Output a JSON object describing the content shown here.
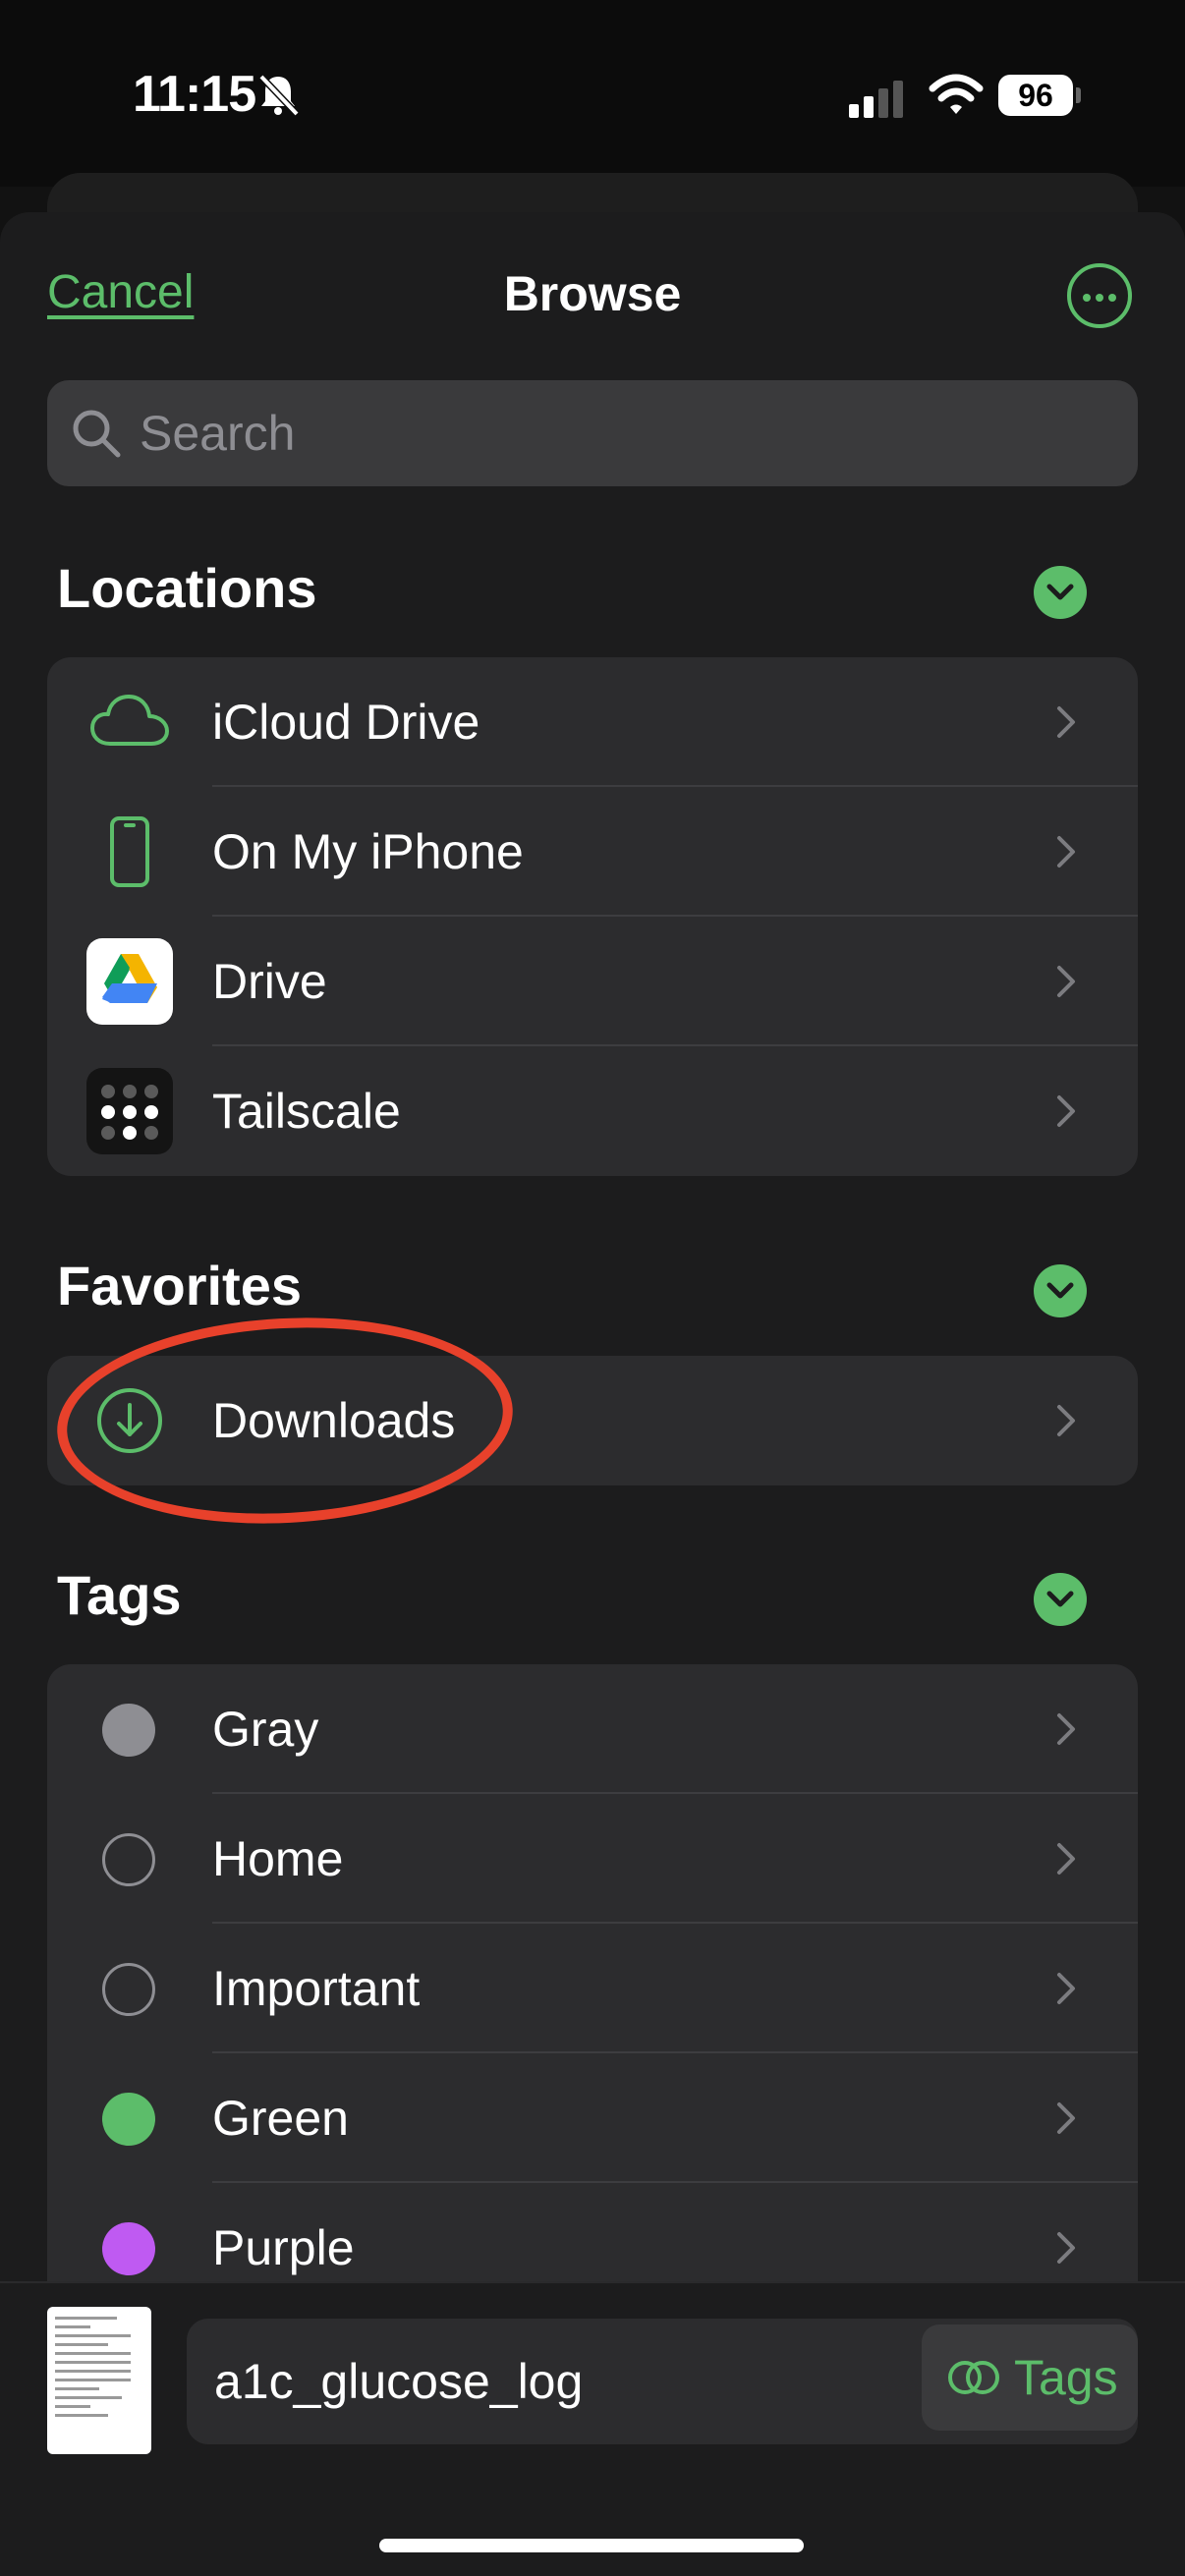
{
  "status": {
    "time": "11:15",
    "battery": "96",
    "icons": [
      "bell-slash-icon",
      "signal-icon",
      "wifi-icon",
      "battery-icon"
    ]
  },
  "header": {
    "cancel": "Cancel",
    "title": "Browse",
    "more_icon": "ellipsis-circle-icon"
  },
  "search": {
    "placeholder": "Search",
    "icon": "search-icon"
  },
  "locations": {
    "title": "Locations",
    "items": [
      {
        "label": "iCloud Drive",
        "icon": "cloud-icon"
      },
      {
        "label": "On My iPhone",
        "icon": "iphone-icon"
      },
      {
        "label": "Drive",
        "icon": "google-drive-icon"
      },
      {
        "label": "Tailscale",
        "icon": "tailscale-icon"
      }
    ]
  },
  "favorites": {
    "title": "Favorites",
    "items": [
      {
        "label": "Downloads",
        "icon": "download-circle-icon"
      }
    ]
  },
  "tags": {
    "title": "Tags",
    "items": [
      {
        "label": "Gray",
        "color": "#8e8e93"
      },
      {
        "label": "Home",
        "color": ""
      },
      {
        "label": "Important",
        "color": ""
      },
      {
        "label": "Green",
        "color": "#5cbd6a"
      },
      {
        "label": "Purple",
        "color": "#bf5af2"
      }
    ]
  },
  "bottom": {
    "filename": "a1c_glucose_log",
    "tags_label": "Tags"
  },
  "colors": {
    "accent": "#5cbd6a",
    "highlight": "#e8412b"
  }
}
